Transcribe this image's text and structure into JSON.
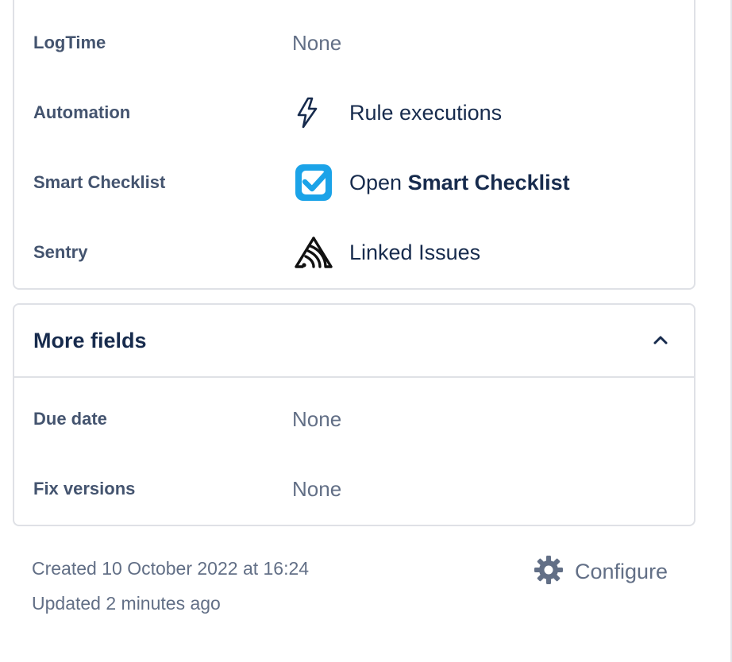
{
  "details": {
    "rows": [
      {
        "label": "LogTime",
        "value": "None"
      },
      {
        "label": "Automation",
        "link": "Rule executions",
        "icon": "lightning-bolt-icon"
      },
      {
        "label": "Smart Checklist",
        "link_prefix": "Open ",
        "link_bold": "Smart Checklist",
        "icon": "smart-checklist-icon"
      },
      {
        "label": "Sentry",
        "link": "Linked Issues",
        "icon": "sentry-icon"
      }
    ]
  },
  "more_fields": {
    "title": "More fields",
    "toggle_icon": "chevron-up-icon",
    "rows": [
      {
        "label": "Due date",
        "value": "None"
      },
      {
        "label": "Fix versions",
        "value": "None"
      }
    ]
  },
  "meta": {
    "created": "Created 10 October 2022 at 16:24",
    "updated": "Updated 2 minutes ago"
  },
  "configure": {
    "label": "Configure",
    "icon": "gear-icon"
  },
  "colors": {
    "checklist_blue": "#1ba3e8",
    "label_gray": "#44546f",
    "value_gray": "#626f86",
    "border": "#dfe1e6"
  }
}
